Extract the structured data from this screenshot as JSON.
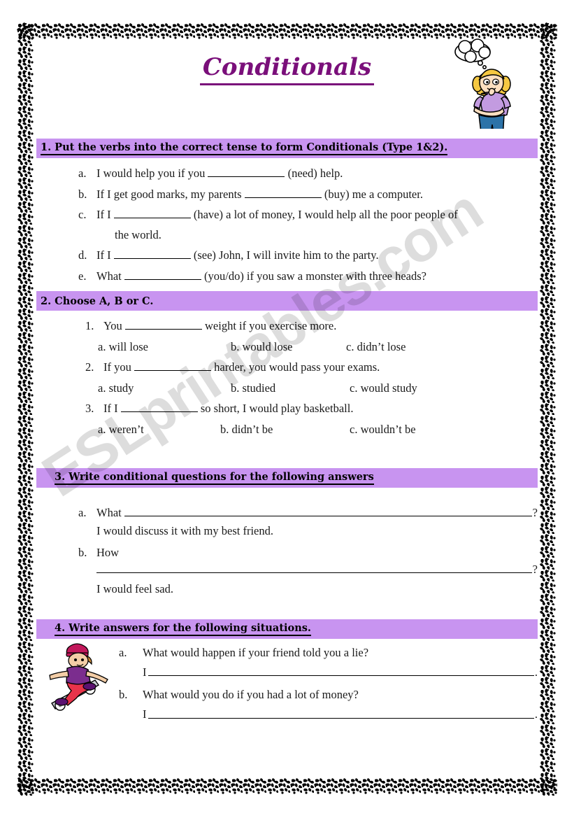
{
  "page": {
    "title": "Conditionals",
    "watermark": "ESLprintables.com",
    "accent_bar_color": "#C894F0",
    "title_color": "#7A0F7A"
  },
  "clipart": {
    "girl": "thinking-girl-icon",
    "skater": "skateboarder-icon"
  },
  "sections": [
    {
      "heading": "1. Put the verbs into the correct tense to form Conditionals (Type 1&2).",
      "items": [
        {
          "mark": "a.",
          "pre": "I would help you if you",
          "post": "(need) help.",
          "cont": ""
        },
        {
          "mark": "b.",
          "pre": "If I get good marks, my parents",
          "post": "(buy) me a computer.",
          "cont": ""
        },
        {
          "mark": "c.",
          "pre": "If I",
          "post": "(have) a lot of money, I would help all the poor people of",
          "cont": "the world."
        },
        {
          "mark": "d.",
          "pre": "If I",
          "post": "(see) John, I will invite him to the party.",
          "cont": ""
        },
        {
          "mark": "e.",
          "pre": "What",
          "post": "(you/do) if you saw a monster with three heads?",
          "cont": ""
        }
      ]
    },
    {
      "heading": "2. Choose A, B or C.",
      "questions": [
        {
          "mark": "1.",
          "pre": "You",
          "post": "weight if you exercise more.",
          "options": [
            "a. will lose",
            "b.  would lose",
            "c. didn’t lose"
          ]
        },
        {
          "mark": "2.",
          "pre": "If you",
          "post": "harder, you would pass your exams.",
          "options": [
            "a.   study",
            "b.  studied",
            "c. would study"
          ]
        },
        {
          "mark": "3.",
          "pre": "If I",
          "post": "so short, I would play basketball.",
          "options": [
            "a.   weren’t",
            "b. didn’t be",
            "c. wouldn’t be"
          ]
        }
      ]
    },
    {
      "heading": "3. Write conditional questions for the following answers",
      "items": [
        {
          "mark": "a.",
          "prompt": "What",
          "tail": "?",
          "answer": "I would discuss it with my best friend.",
          "rule_below": false
        },
        {
          "mark": "b.",
          "prompt": "How",
          "tail": "?",
          "answer": "I would feel sad.",
          "rule_below": true
        }
      ]
    },
    {
      "heading": "4. Write answers for the following situations.",
      "items": [
        {
          "mark": "a.",
          "question": "What would happen if your friend told you a lie?",
          "answer_start": "I",
          "answer_end": "."
        },
        {
          "mark": "b.",
          "question": "What would you do if you had a lot of money?",
          "answer_start": "I",
          "answer_end": "."
        }
      ]
    }
  ]
}
